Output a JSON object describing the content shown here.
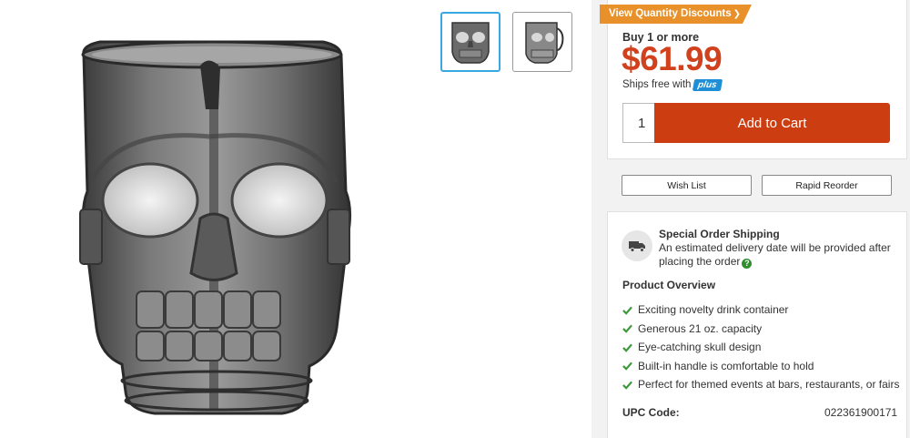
{
  "product": {
    "image_icon": "skull-mug-image",
    "thumbnails": [
      {
        "icon": "skull-mug-front-thumbnail",
        "selected": true
      },
      {
        "icon": "skull-mug-side-thumbnail",
        "selected": false
      }
    ]
  },
  "pricing": {
    "quantity_discounts_label": "View Quantity Discounts",
    "buy_label": "Buy 1 or more",
    "price": "$61.99",
    "ships_free_label": "Ships free with",
    "plus_badge": "plus"
  },
  "cart": {
    "quantity_value": "1",
    "add_to_cart_label": "Add to Cart"
  },
  "actions": {
    "wish_list_label": "Wish List",
    "rapid_reorder_label": "Rapid Reorder"
  },
  "shipping": {
    "title": "Special Order Shipping",
    "description": "An estimated delivery date will be provided after placing the order",
    "help_icon": "question-icon"
  },
  "overview": {
    "title": "Product Overview",
    "features": [
      "Exciting novelty drink container",
      "Generous 21 oz. capacity",
      "Eye-catching skull design",
      "Built-in handle is comfortable to hold",
      "Perfect for themed events at bars, restaurants, or fairs"
    ]
  },
  "upc": {
    "label": "UPC Code:",
    "value": "022361900171"
  },
  "colors": {
    "price": "#d2411d",
    "add_to_cart": "#cc3e12",
    "discount_tag": "#e8912a",
    "plus_badge": "#1e8fd6",
    "check": "#3a9a3a"
  }
}
